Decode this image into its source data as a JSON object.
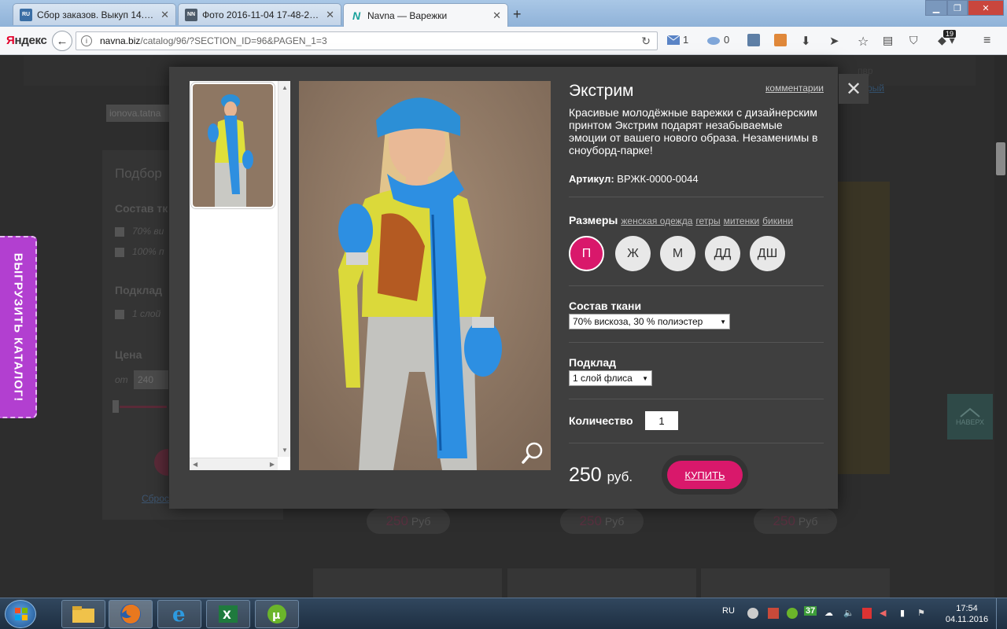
{
  "browser": {
    "tabs": [
      {
        "favicon": "RU",
        "favicon_color": "#3a6ea5",
        "title": "Сбор заказов. Выкуп 14. А...",
        "active": false
      },
      {
        "favicon": "NN",
        "favicon_color": "#4d5b6a",
        "title": "Фото 2016-11-04 17-48-20....",
        "active": false
      },
      {
        "favicon": "N",
        "favicon_color": "#18a19a",
        "title": "Navna — Варежки",
        "active": true
      }
    ],
    "new_tab": "+",
    "brand": {
      "first": "Я",
      "rest": "ндекс"
    },
    "url": {
      "host": "navna.biz",
      "path": "/catalog/96/?SECTION_ID=96&PAGEN_1=3"
    },
    "mail_count": "1",
    "weather_count": "0",
    "notif_count": "19"
  },
  "background_page": {
    "search_text": "ionova.tatna",
    "filter_title": "Подбор",
    "fabric_label": "Состав тк",
    "opt1": "70% ви",
    "opt2": "100% п",
    "lining_label": "Подклад",
    "lining_opt": "1 слой",
    "price_label": "Цена",
    "price_from": "от",
    "price_from_value": "240",
    "reset": "Сброс",
    "export_tab": "ВЫГРУЗИТЬ КАТАЛОГ!",
    "top_right_text1": "пвр",
    "top_right_text2": "рый",
    "up_button": "НАВЕРХ",
    "card_prices": [
      {
        "value": "250",
        "unit": "Руб"
      },
      {
        "value": "250",
        "unit": "Руб"
      },
      {
        "value": "250",
        "unit": "Руб"
      }
    ]
  },
  "product": {
    "title": "Экстрим",
    "comments_link": "комментарии",
    "description": "Красивые молодёжные варежки с дизайнерским принтом Экстрим подарят незабываемые эмоции от вашего нового образа. Незаменимы в сноуборд-парке!",
    "article_label": "Артикул:",
    "article_value": "ВРЖК-0000-0044",
    "sizes_label": "Размеры",
    "size_links": [
      "женская одежда",
      "гетры",
      "митенки",
      "бикини"
    ],
    "sizes": [
      "П",
      "Ж",
      "М",
      "ДД",
      "ДШ"
    ],
    "selected_size": 0,
    "fabric_label": "Состав ткани",
    "fabric_value": "70% вискоза, 30 % полиэстер",
    "lining_label": "Подклад",
    "lining_value": "1 слой флиса",
    "qty_label": "Количество",
    "qty_value": "1",
    "price_value": "250",
    "price_unit": "руб.",
    "buy_label": "КУПИТЬ",
    "accent_color": "#d9186b"
  },
  "taskbar": {
    "lang": "RU",
    "tray_badge": "37",
    "time": "17:54",
    "date": "04.11.2016"
  }
}
